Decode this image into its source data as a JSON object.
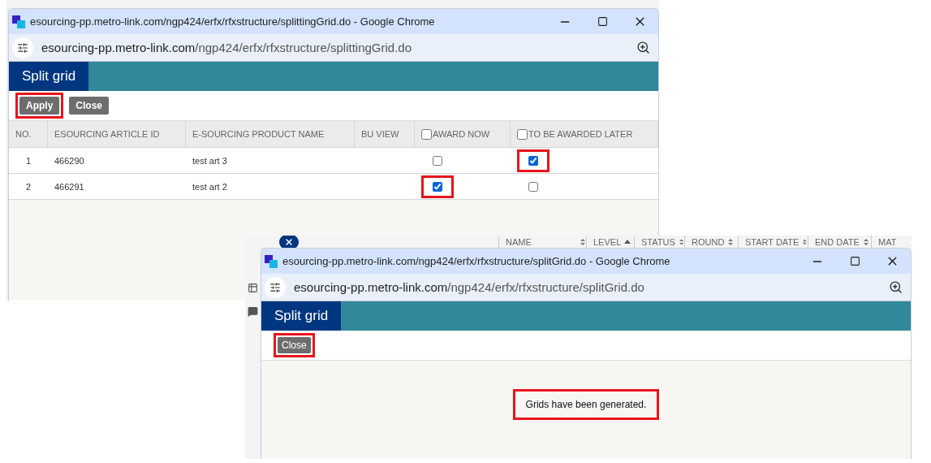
{
  "splitting_window": {
    "title": "esourcing-pp.metro-link.com/ngp424/erfx/rfxstructure/splittingGrid.do - Google Chrome",
    "url_domain": "esourcing-pp.metro-link.com",
    "url_path": "/ngp424/erfx/rfxstructure/splittingGrid.do",
    "page_title": "Split grid",
    "buttons": [
      {
        "label": "Apply",
        "highlighted": true
      },
      {
        "label": "Close",
        "highlighted": false
      }
    ],
    "grid": {
      "columns": [
        {
          "label": "NO.",
          "kind": "text"
        },
        {
          "label": "ESOURCING ARTICLE ID",
          "kind": "text"
        },
        {
          "label": "E-SOURCING PRODUCT NAME",
          "kind": "text"
        },
        {
          "label": "BU VIEW",
          "kind": "text"
        },
        {
          "label": "AWARD NOW",
          "kind": "checkbox",
          "checked": false
        },
        {
          "label": "TO BE AWARDED LATER",
          "kind": "checkbox",
          "checked": false
        }
      ],
      "rows": [
        {
          "no": "1",
          "article_id": "466290",
          "product_name": "test art 3",
          "award_now": {
            "checked": false,
            "highlighted": false
          },
          "awarded_later": {
            "checked": true,
            "highlighted": true
          }
        },
        {
          "no": "2",
          "article_id": "466291",
          "product_name": "test art 2",
          "award_now": {
            "checked": true,
            "highlighted": true
          },
          "awarded_later": {
            "checked": false,
            "highlighted": false
          }
        }
      ]
    }
  },
  "result_window": {
    "background_columns": [
      {
        "label": "NAME",
        "sorted": false
      },
      {
        "label": "LEVEL",
        "sorted": true
      },
      {
        "label": "STATUS",
        "sorted": false
      },
      {
        "label": "ROUND",
        "sorted": false
      },
      {
        "label": "START DATE",
        "sorted": false
      },
      {
        "label": "END DATE",
        "sorted": false
      },
      {
        "label": "MAT"
      }
    ],
    "title": "esourcing-pp.metro-link.com/ngp424/erfx/rfxstructure/splitGrid.do - Google Chrome",
    "url_domain": "esourcing-pp.metro-link.com",
    "url_path": "/ngp424/erfx/rfxstructure/splitGrid.do",
    "page_title": "Split grid",
    "buttons": [
      {
        "label": "Close",
        "highlighted": true
      }
    ],
    "message": {
      "text": "Grids have been generated.",
      "highlighted": true
    }
  }
}
